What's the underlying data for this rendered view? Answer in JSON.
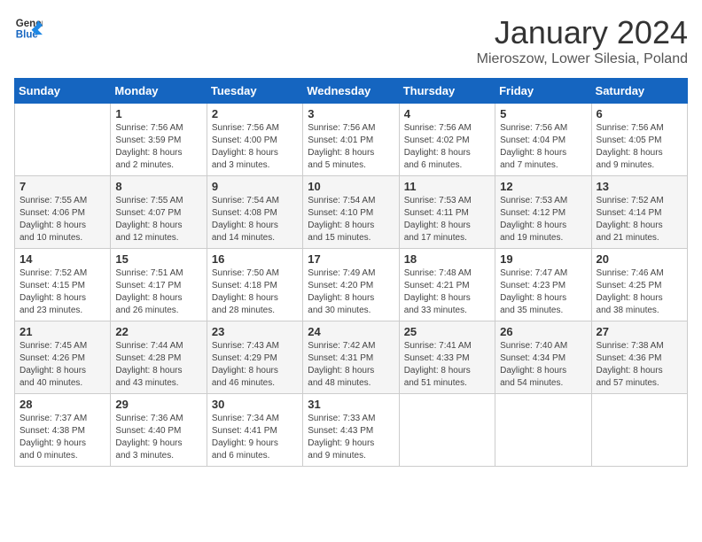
{
  "header": {
    "logo_line1": "General",
    "logo_line2": "Blue",
    "month": "January 2024",
    "location": "Mieroszow, Lower Silesia, Poland"
  },
  "weekdays": [
    "Sunday",
    "Monday",
    "Tuesday",
    "Wednesday",
    "Thursday",
    "Friday",
    "Saturday"
  ],
  "weeks": [
    [
      {
        "day": "",
        "info": ""
      },
      {
        "day": "1",
        "info": "Sunrise: 7:56 AM\nSunset: 3:59 PM\nDaylight: 8 hours\nand 2 minutes."
      },
      {
        "day": "2",
        "info": "Sunrise: 7:56 AM\nSunset: 4:00 PM\nDaylight: 8 hours\nand 3 minutes."
      },
      {
        "day": "3",
        "info": "Sunrise: 7:56 AM\nSunset: 4:01 PM\nDaylight: 8 hours\nand 5 minutes."
      },
      {
        "day": "4",
        "info": "Sunrise: 7:56 AM\nSunset: 4:02 PM\nDaylight: 8 hours\nand 6 minutes."
      },
      {
        "day": "5",
        "info": "Sunrise: 7:56 AM\nSunset: 4:04 PM\nDaylight: 8 hours\nand 7 minutes."
      },
      {
        "day": "6",
        "info": "Sunrise: 7:56 AM\nSunset: 4:05 PM\nDaylight: 8 hours\nand 9 minutes."
      }
    ],
    [
      {
        "day": "7",
        "info": "Sunrise: 7:55 AM\nSunset: 4:06 PM\nDaylight: 8 hours\nand 10 minutes."
      },
      {
        "day": "8",
        "info": "Sunrise: 7:55 AM\nSunset: 4:07 PM\nDaylight: 8 hours\nand 12 minutes."
      },
      {
        "day": "9",
        "info": "Sunrise: 7:54 AM\nSunset: 4:08 PM\nDaylight: 8 hours\nand 14 minutes."
      },
      {
        "day": "10",
        "info": "Sunrise: 7:54 AM\nSunset: 4:10 PM\nDaylight: 8 hours\nand 15 minutes."
      },
      {
        "day": "11",
        "info": "Sunrise: 7:53 AM\nSunset: 4:11 PM\nDaylight: 8 hours\nand 17 minutes."
      },
      {
        "day": "12",
        "info": "Sunrise: 7:53 AM\nSunset: 4:12 PM\nDaylight: 8 hours\nand 19 minutes."
      },
      {
        "day": "13",
        "info": "Sunrise: 7:52 AM\nSunset: 4:14 PM\nDaylight: 8 hours\nand 21 minutes."
      }
    ],
    [
      {
        "day": "14",
        "info": "Sunrise: 7:52 AM\nSunset: 4:15 PM\nDaylight: 8 hours\nand 23 minutes."
      },
      {
        "day": "15",
        "info": "Sunrise: 7:51 AM\nSunset: 4:17 PM\nDaylight: 8 hours\nand 26 minutes."
      },
      {
        "day": "16",
        "info": "Sunrise: 7:50 AM\nSunset: 4:18 PM\nDaylight: 8 hours\nand 28 minutes."
      },
      {
        "day": "17",
        "info": "Sunrise: 7:49 AM\nSunset: 4:20 PM\nDaylight: 8 hours\nand 30 minutes."
      },
      {
        "day": "18",
        "info": "Sunrise: 7:48 AM\nSunset: 4:21 PM\nDaylight: 8 hours\nand 33 minutes."
      },
      {
        "day": "19",
        "info": "Sunrise: 7:47 AM\nSunset: 4:23 PM\nDaylight: 8 hours\nand 35 minutes."
      },
      {
        "day": "20",
        "info": "Sunrise: 7:46 AM\nSunset: 4:25 PM\nDaylight: 8 hours\nand 38 minutes."
      }
    ],
    [
      {
        "day": "21",
        "info": "Sunrise: 7:45 AM\nSunset: 4:26 PM\nDaylight: 8 hours\nand 40 minutes."
      },
      {
        "day": "22",
        "info": "Sunrise: 7:44 AM\nSunset: 4:28 PM\nDaylight: 8 hours\nand 43 minutes."
      },
      {
        "day": "23",
        "info": "Sunrise: 7:43 AM\nSunset: 4:29 PM\nDaylight: 8 hours\nand 46 minutes."
      },
      {
        "day": "24",
        "info": "Sunrise: 7:42 AM\nSunset: 4:31 PM\nDaylight: 8 hours\nand 48 minutes."
      },
      {
        "day": "25",
        "info": "Sunrise: 7:41 AM\nSunset: 4:33 PM\nDaylight: 8 hours\nand 51 minutes."
      },
      {
        "day": "26",
        "info": "Sunrise: 7:40 AM\nSunset: 4:34 PM\nDaylight: 8 hours\nand 54 minutes."
      },
      {
        "day": "27",
        "info": "Sunrise: 7:38 AM\nSunset: 4:36 PM\nDaylight: 8 hours\nand 57 minutes."
      }
    ],
    [
      {
        "day": "28",
        "info": "Sunrise: 7:37 AM\nSunset: 4:38 PM\nDaylight: 9 hours\nand 0 minutes."
      },
      {
        "day": "29",
        "info": "Sunrise: 7:36 AM\nSunset: 4:40 PM\nDaylight: 9 hours\nand 3 minutes."
      },
      {
        "day": "30",
        "info": "Sunrise: 7:34 AM\nSunset: 4:41 PM\nDaylight: 9 hours\nand 6 minutes."
      },
      {
        "day": "31",
        "info": "Sunrise: 7:33 AM\nSunset: 4:43 PM\nDaylight: 9 hours\nand 9 minutes."
      },
      {
        "day": "",
        "info": ""
      },
      {
        "day": "",
        "info": ""
      },
      {
        "day": "",
        "info": ""
      }
    ]
  ]
}
